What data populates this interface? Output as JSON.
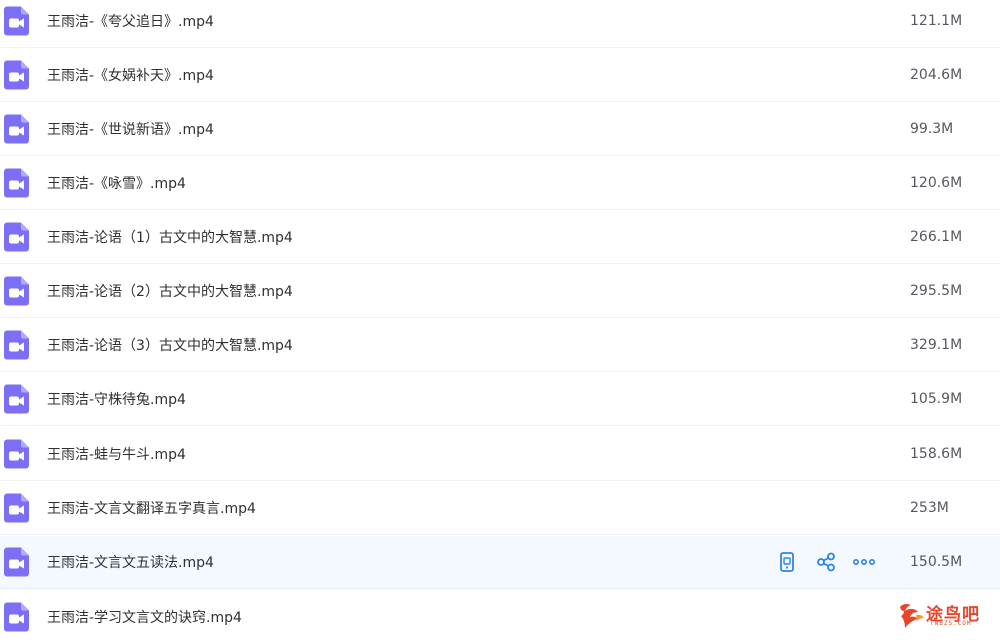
{
  "files": [
    {
      "name": "王雨洁-《夸父追日》.mp4",
      "size": "121.1M"
    },
    {
      "name": "王雨洁-《女娲补天》.mp4",
      "size": "204.6M"
    },
    {
      "name": "王雨洁-《世说新语》.mp4",
      "size": "99.3M"
    },
    {
      "name": "王雨洁-《咏雪》.mp4",
      "size": "120.6M"
    },
    {
      "name": "王雨洁-论语（1）古文中的大智慧.mp4",
      "size": "266.1M"
    },
    {
      "name": "王雨洁-论语（2）古文中的大智慧.mp4",
      "size": "295.5M"
    },
    {
      "name": "王雨洁-论语（3）古文中的大智慧.mp4",
      "size": "329.1M"
    },
    {
      "name": "王雨洁-守株待兔.mp4",
      "size": "105.9M"
    },
    {
      "name": "王雨洁-蛙与牛斗.mp4",
      "size": "158.6M"
    },
    {
      "name": "王雨洁-文言文翻译五字真言.mp4",
      "size": "253M"
    },
    {
      "name": "王雨洁-文言文五读法.mp4",
      "size": "150.5M"
    },
    {
      "name": "王雨洁-学习文言文的诀窍.mp4",
      "size": ""
    }
  ],
  "hovered_index": 10,
  "icons": {
    "file": "video-file-icon",
    "phone": "phone-icon",
    "share": "share-icon",
    "more": "more-icon"
  },
  "colors": {
    "file_icon": "#7c6ff5",
    "action": "#2e84ea",
    "hover_bg": "#f3f9ff",
    "watermark": "#e8462b"
  },
  "watermark": {
    "text": "途鸟吧",
    "sub": "TNBZS.COM"
  }
}
